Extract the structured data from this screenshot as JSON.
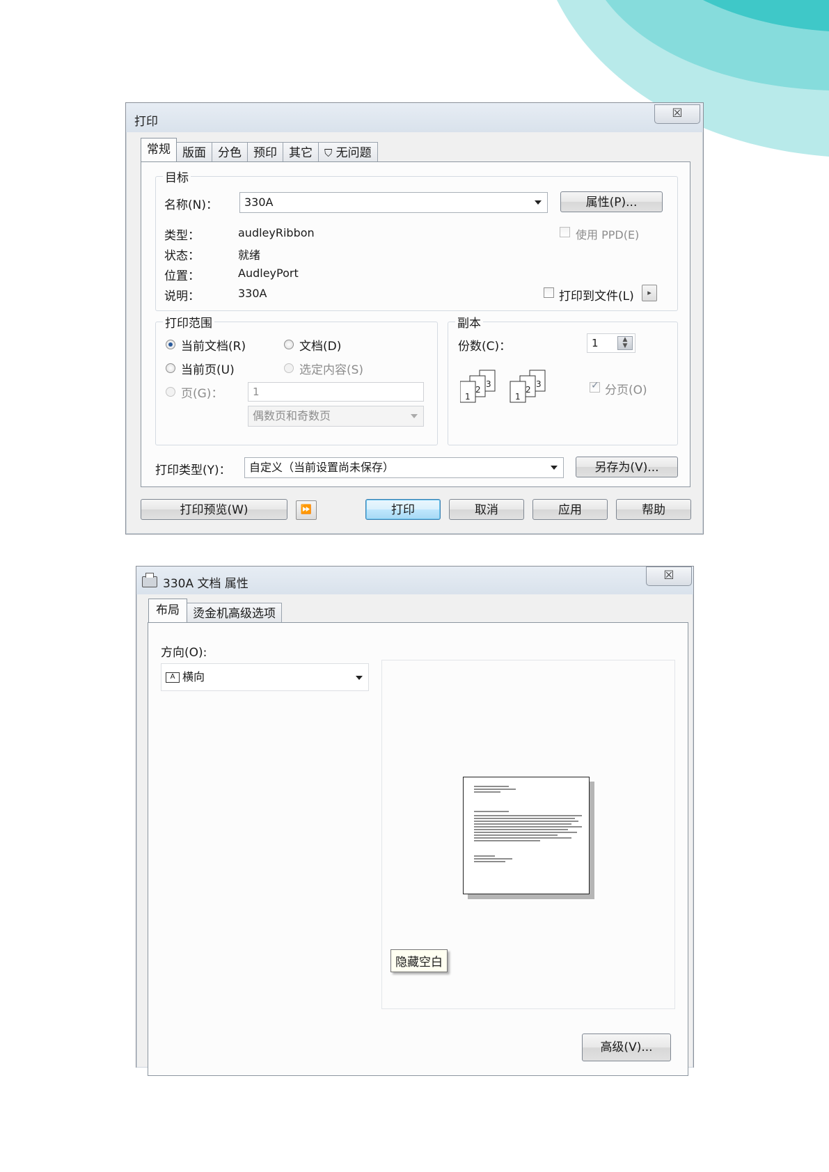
{
  "print_dialog": {
    "title": "打印",
    "close_label": "☒",
    "tabs": [
      {
        "label": "常规"
      },
      {
        "label": "版面"
      },
      {
        "label": "分色"
      },
      {
        "label": "预印"
      },
      {
        "label": "其它"
      },
      {
        "label": "无问题"
      }
    ],
    "target": {
      "legend": "目标",
      "name_label": "名称(N)：",
      "name_value": "330A",
      "properties_button": "属性(P)...",
      "type_label": "类型：",
      "type_value": "audleyRibbon",
      "status_label": "状态：",
      "status_value": "就绪",
      "location_label": "位置：",
      "location_value": "AudleyPort",
      "comment_label": "说明：",
      "comment_value": "330A",
      "use_ppd_label": "使用 PPD(E)",
      "print_to_file_label": "打印到文件(L)"
    },
    "range": {
      "legend": "打印范围",
      "current_doc": "当前文档(R)",
      "documents": "文档(D)",
      "current_page": "当前页(U)",
      "selection": "选定内容(S)",
      "pages_label": "页(G)：",
      "pages_value": "1",
      "page_set": "偶数页和奇数页"
    },
    "copies": {
      "legend": "副本",
      "count_label": "份数(C)：",
      "count_value": "1",
      "collate_label": "分页(O)",
      "page_numbers": [
        "1",
        "2",
        "3"
      ]
    },
    "print_style_label": "打印类型(Y)：",
    "print_style_value": "自定义（当前设置尚未保存）",
    "save_as_button": "另存为(V)...",
    "preview_button": "打印预览(W)",
    "print_button": "打印",
    "cancel_button": "取消",
    "apply_button": "应用",
    "help_button": "帮助"
  },
  "properties_dialog": {
    "title": "330A 文档 属性",
    "close_label": "☒",
    "tabs": [
      {
        "label": "布局"
      },
      {
        "label": "烫金机高级选项"
      }
    ],
    "orientation_label": "方向(O):",
    "orientation_value": "横向",
    "orientation_icon_letter": "A",
    "tooltip": "隐藏空白",
    "advanced_button": "高级(V)..."
  },
  "colors": {
    "swoosh_light": "#b3e8e8",
    "swoosh_mid": "#7fdada",
    "swoosh_dark": "#3cc7c7",
    "default_button_border": "#3c7fb1"
  }
}
